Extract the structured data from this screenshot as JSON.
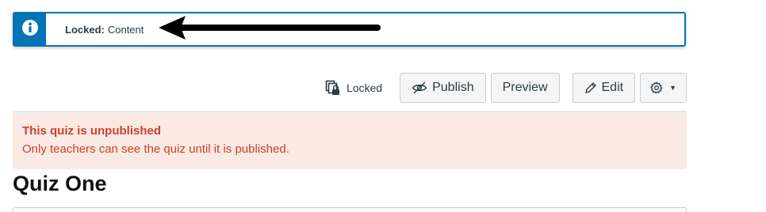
{
  "banner": {
    "label": "Locked:",
    "value": "Content",
    "accent_color": "#0374b5",
    "icon": "info-icon"
  },
  "toolbar": {
    "locked_label": "Locked",
    "locked_icon": "lock-copy-icon",
    "publish_label": "Publish",
    "publish_icon": "eye-slash-icon",
    "preview_label": "Preview",
    "edit_label": "Edit",
    "edit_icon": "pencil-icon",
    "settings_icon": "gear-icon",
    "settings_caret": "▼"
  },
  "alert": {
    "heading": "This quiz is unpublished",
    "body": "Only teachers can see the quiz until it is published.",
    "text_color": "#c9432c",
    "background_color": "#fbe9e4"
  },
  "page": {
    "title": "Quiz One"
  }
}
